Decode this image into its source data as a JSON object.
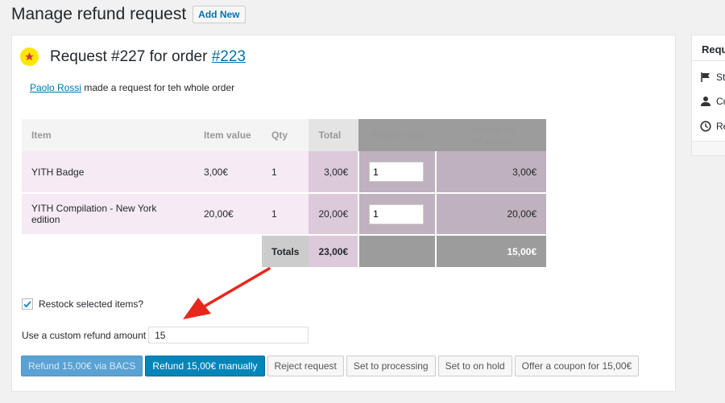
{
  "page": {
    "title": "Manage refund request",
    "add_new": "Add New"
  },
  "request": {
    "title_prefix": "Request #227 for order ",
    "order_link": "#223",
    "requester_name": "Paolo Rossi",
    "requester_text": " made a request for teh whole order"
  },
  "table": {
    "headers": {
      "item": "Item",
      "item_value": "Item value",
      "qty": "Qty",
      "total": "Total",
      "refund_qty": "Refund Qty",
      "total_refunded": "Total to be refunded"
    },
    "rows": [
      {
        "item": "YITH Badge",
        "item_value": "3,00€",
        "qty": "1",
        "total": "3,00€",
        "refund_qty": "1",
        "total_refunded": "3,00€"
      },
      {
        "item": "YITH Compilation - New York edition",
        "item_value": "20,00€",
        "qty": "1",
        "total": "20,00€",
        "refund_qty": "1",
        "total_refunded": "20,00€"
      }
    ],
    "totals": {
      "label": "Totals",
      "total": "23,00€",
      "total_refunded": "15,00€"
    }
  },
  "restock": {
    "label": "Restock selected items?",
    "checked": true
  },
  "custom_amount": {
    "label": "Use a custom refund amount",
    "value": "15"
  },
  "actions": {
    "refund_bacs": "Refund 15,00€ via BACS",
    "refund_manual": "Refund 15,00€ manually",
    "reject": "Reject request",
    "processing": "Set to processing",
    "on_hold": "Set to on hold",
    "coupon": "Offer a coupon for 15,00€"
  },
  "sidebar": {
    "title": "Requ",
    "rows": [
      {
        "icon": "flag-icon",
        "label": "St"
      },
      {
        "icon": "user-icon",
        "label": "Cu"
      },
      {
        "icon": "clock-icon",
        "label": "Re"
      }
    ]
  },
  "colors": {
    "link": "#0073aa",
    "primary_button": "#0085ba",
    "arrow": "#e8271c",
    "star_badge": "#ffe600"
  }
}
